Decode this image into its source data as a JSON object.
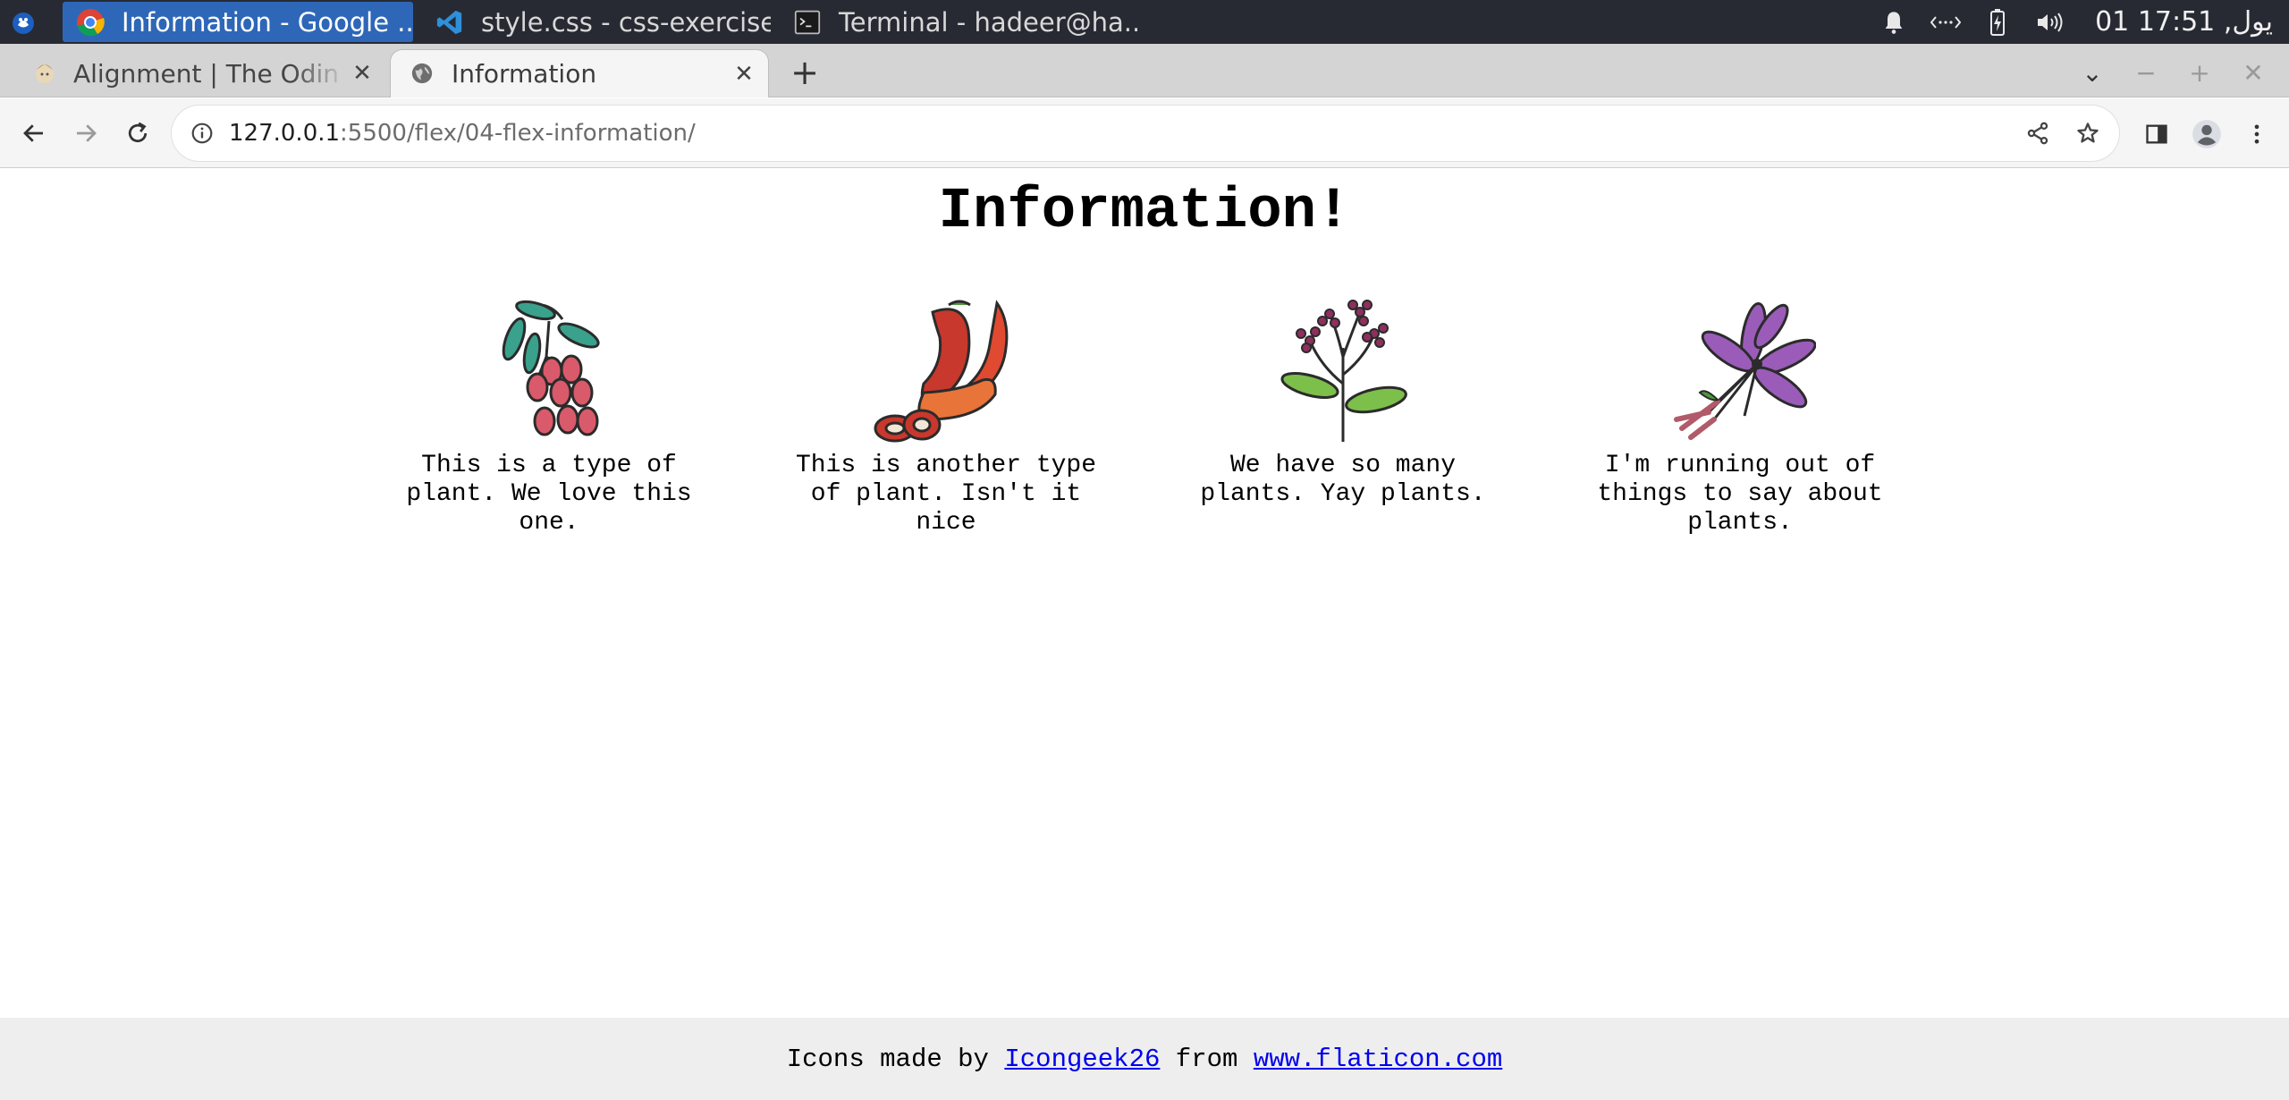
{
  "taskbar": {
    "tasks": [
      {
        "label": "Information - Google ...",
        "icon": "chrome-icon"
      },
      {
        "label": "style.css - css-exercise...",
        "icon": "vscode-icon"
      },
      {
        "label": "Terminal - hadeer@ha...",
        "icon": "terminal-icon"
      }
    ],
    "clock": "01 يول, 17:51"
  },
  "browser": {
    "tabs": [
      {
        "label": "Alignment | The Odin P",
        "active": false
      },
      {
        "label": "Information",
        "active": true
      }
    ],
    "url_host": "127.0.0.1",
    "url_rest": ":5500/flex/04-flex-information/"
  },
  "page": {
    "title": "Information!",
    "cards": [
      {
        "text": "This is a type of plant. We love this one.",
        "icon": "berries-icon"
      },
      {
        "text": "This is another type of plant. Isn't it nice",
        "icon": "chili-pepper-icon"
      },
      {
        "text": "We have so many plants. Yay plants.",
        "icon": "flowering-plant-icon"
      },
      {
        "text": "I'm running out of things to say about plants.",
        "icon": "saffron-flower-icon"
      }
    ],
    "footer": {
      "prefix": "Icons made by ",
      "author": "Icongeek26",
      "middle": " from ",
      "site": "www.flaticon.com"
    }
  },
  "colors": {
    "taskbar_bg": "#272a33",
    "active_task": "#2e67b8",
    "link": "#0000ee",
    "footer_bg": "#eeeeee"
  }
}
